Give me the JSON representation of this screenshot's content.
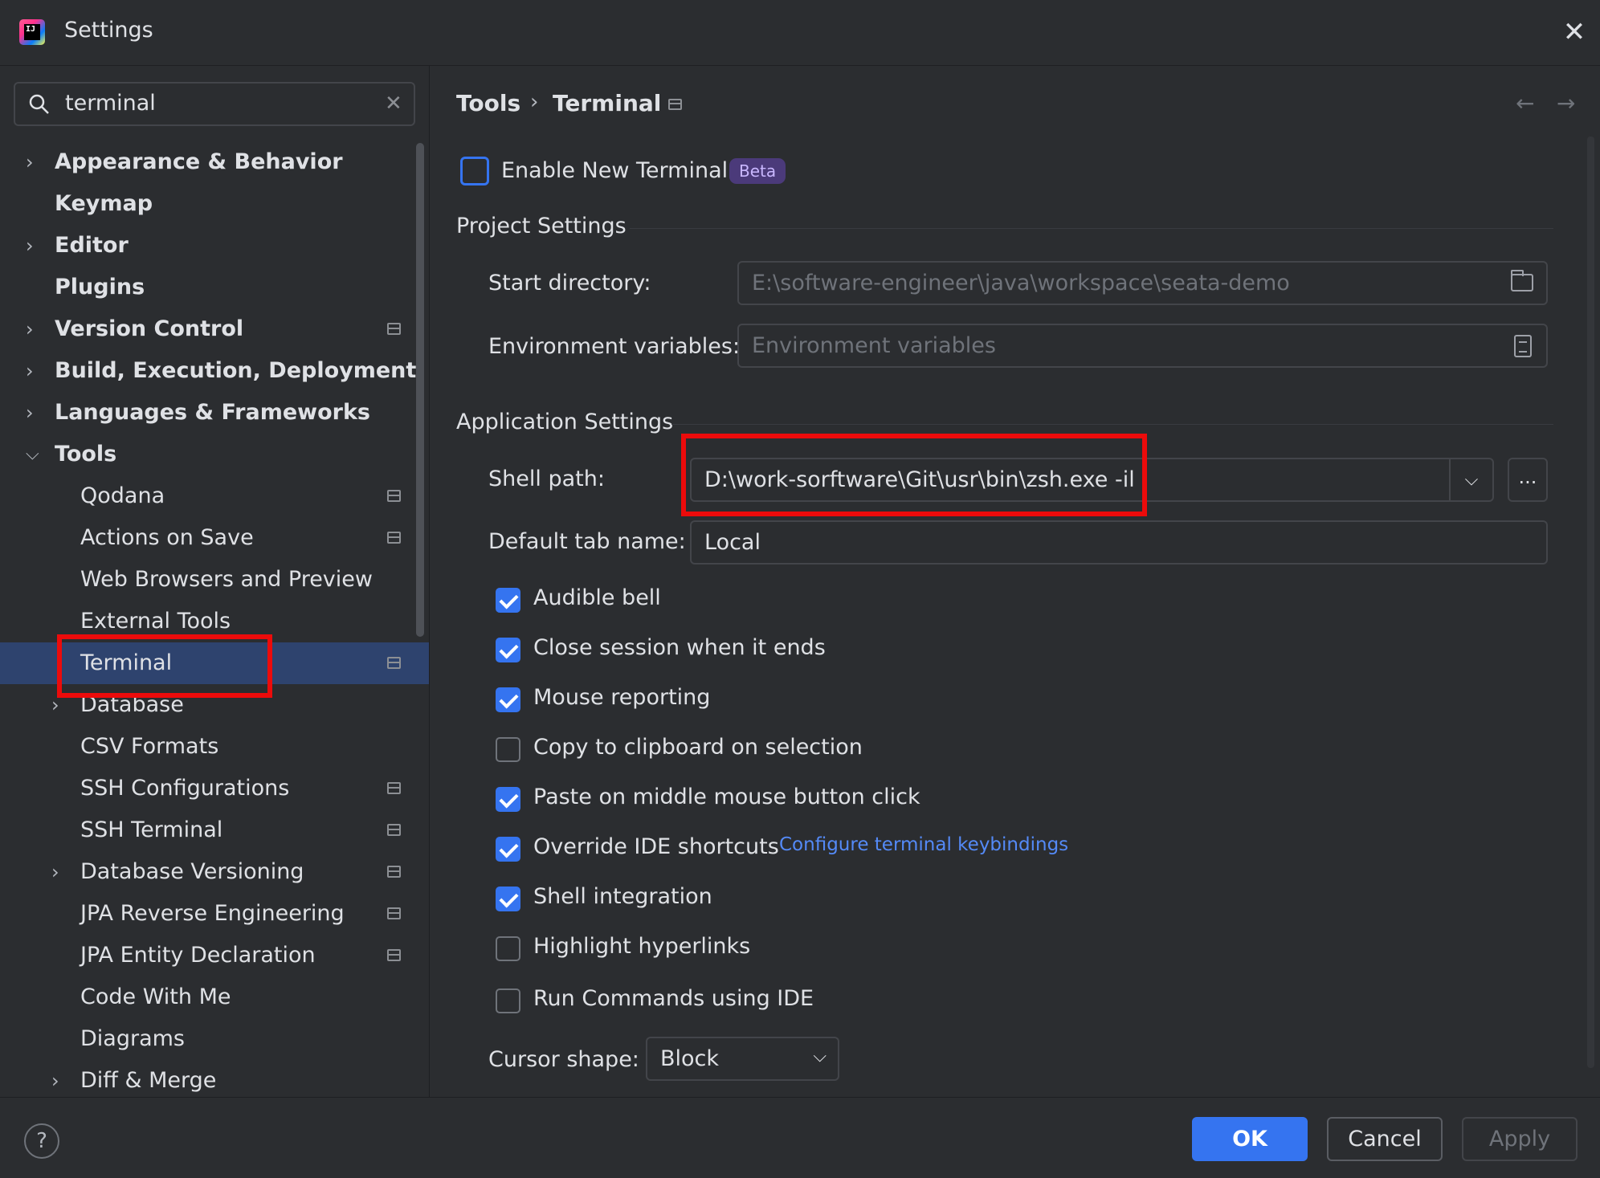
{
  "window": {
    "title": "Settings",
    "logo_text": "IJ"
  },
  "search": {
    "query": "terminal",
    "clear_icon": "✕"
  },
  "tree": [
    {
      "label": "Appearance & Behavior",
      "expandable": true,
      "expanded": false,
      "bold": true,
      "level": 0
    },
    {
      "label": "Keymap",
      "expandable": false,
      "bold": true,
      "level": 0
    },
    {
      "label": "Editor",
      "expandable": true,
      "expanded": false,
      "bold": true,
      "level": 0
    },
    {
      "label": "Plugins",
      "expandable": false,
      "bold": true,
      "level": 0
    },
    {
      "label": "Version Control",
      "expandable": true,
      "expanded": false,
      "bold": true,
      "level": 0,
      "project_icon": true
    },
    {
      "label": "Build, Execution, Deployment",
      "expandable": true,
      "expanded": false,
      "bold": true,
      "level": 0
    },
    {
      "label": "Languages & Frameworks",
      "expandable": true,
      "expanded": false,
      "bold": true,
      "level": 0
    },
    {
      "label": "Tools",
      "expandable": true,
      "expanded": true,
      "bold": true,
      "level": 0
    },
    {
      "label": "Qodana",
      "level": 1,
      "project_icon": true
    },
    {
      "label": "Actions on Save",
      "level": 1,
      "project_icon": true
    },
    {
      "label": "Web Browsers and Preview",
      "level": 1
    },
    {
      "label": "External Tools",
      "level": 1
    },
    {
      "label": "Terminal",
      "level": 1,
      "selected": true,
      "project_icon": true
    },
    {
      "label": "Database",
      "level": 1,
      "expandable": true,
      "expanded": false
    },
    {
      "label": "CSV Formats",
      "level": 1
    },
    {
      "label": "SSH Configurations",
      "level": 1,
      "project_icon": true
    },
    {
      "label": "SSH Terminal",
      "level": 1,
      "project_icon": true
    },
    {
      "label": "Database Versioning",
      "level": 1,
      "expandable": true,
      "expanded": false,
      "project_icon": true
    },
    {
      "label": "JPA Reverse Engineering",
      "level": 1,
      "project_icon": true
    },
    {
      "label": "JPA Entity Declaration",
      "level": 1,
      "project_icon": true
    },
    {
      "label": "Code With Me",
      "level": 1
    },
    {
      "label": "Diagrams",
      "level": 1
    },
    {
      "label": "Diff & Merge",
      "level": 1,
      "expandable": true,
      "expanded": false
    }
  ],
  "breadcrumb": {
    "parent": "Tools",
    "separator": "›",
    "current": "Terminal",
    "back": "←",
    "forward": "→"
  },
  "enable_new_terminal": {
    "label": "Enable New Terminal",
    "checked": false,
    "badge": "Beta"
  },
  "project_settings": {
    "title": "Project Settings",
    "start_directory_label": "Start directory:",
    "start_directory_value": "E:\\software-engineer\\java\\workspace\\seata-demo",
    "env_vars_label": "Environment variables:",
    "env_vars_placeholder": "Environment variables"
  },
  "application_settings": {
    "title": "Application Settings",
    "shell_path_label": "Shell path:",
    "shell_path_value": "D:\\work-sorftware\\Git\\usr\\bin\\zsh.exe -il",
    "browse_label": "...",
    "combo_arrow": "⌵",
    "default_tab_label": "Default tab name:",
    "default_tab_value": "Local"
  },
  "options": [
    {
      "label": "Audible bell",
      "checked": true
    },
    {
      "label": "Close session when it ends",
      "checked": true
    },
    {
      "label": "Mouse reporting",
      "checked": true
    },
    {
      "label": "Copy to clipboard on selection",
      "checked": false
    },
    {
      "label": "Paste on middle mouse button click",
      "checked": true
    },
    {
      "label": "Override IDE shortcuts",
      "checked": true
    },
    {
      "label": "Shell integration",
      "checked": true
    },
    {
      "label": "Highlight hyperlinks",
      "checked": false
    },
    {
      "label": "Run Commands using IDE",
      "checked": false
    }
  ],
  "configure_keybindings_link": "Configure terminal keybindings",
  "cursor_shape": {
    "label": "Cursor shape:",
    "value": "Block",
    "arrow": "⌵"
  },
  "buttons": {
    "help": "?",
    "ok": "OK",
    "cancel": "Cancel",
    "apply": "Apply"
  },
  "colors": {
    "accent": "#3574f0",
    "background": "#2b2d30",
    "selection": "#2e436e",
    "highlight_box": "#ec0b0b",
    "beta_badge": "#4b3a7a"
  }
}
